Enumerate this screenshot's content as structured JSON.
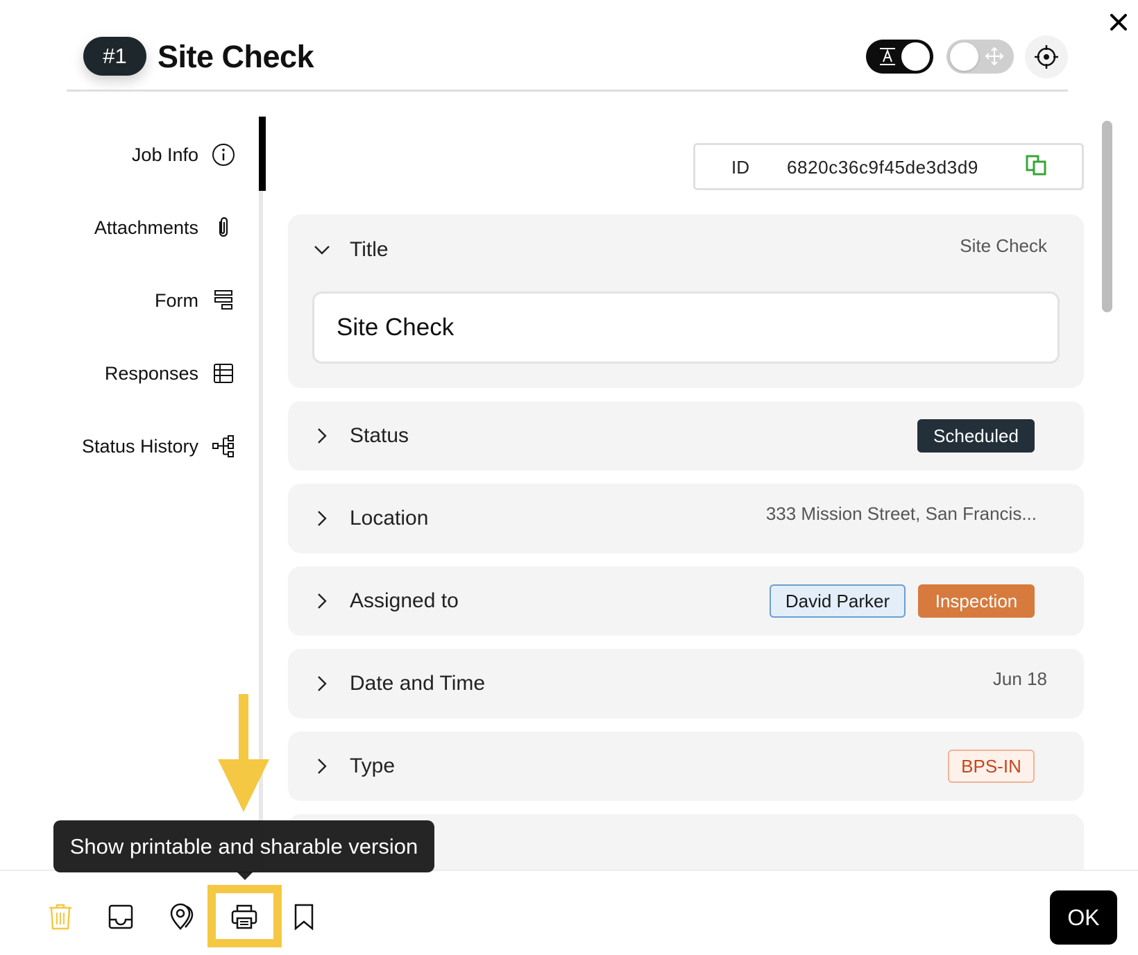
{
  "header": {
    "number_badge": "#1",
    "title": "Site Check"
  },
  "sidebar": {
    "items": [
      {
        "label": "Job Info",
        "icon": "info-circle-icon"
      },
      {
        "label": "Attachments",
        "icon": "paperclip-icon"
      },
      {
        "label": "Form",
        "icon": "form-icon"
      },
      {
        "label": "Responses",
        "icon": "table-icon"
      },
      {
        "label": "Status History",
        "icon": "hierarchy-icon"
      }
    ],
    "active_index": 0
  },
  "id_field": {
    "label": "ID",
    "value": "6820c36c9f45de3d3d9"
  },
  "sections": {
    "title": {
      "label": "Title",
      "summary": "Site Check",
      "input_value": "Site Check"
    },
    "status": {
      "label": "Status",
      "badge": "Scheduled"
    },
    "location": {
      "label": "Location",
      "summary": "333 Mission Street, San Francis..."
    },
    "assigned": {
      "label": "Assigned to",
      "assignee": "David Parker",
      "team": "Inspection"
    },
    "date": {
      "label": "Date and Time",
      "summary": "Jun 18"
    },
    "type": {
      "label": "Type",
      "badge": "BPS-IN"
    }
  },
  "tooltip": {
    "text": "Show printable and sharable version"
  },
  "footer": {
    "icons": [
      "trash-icon",
      "inbox-icon",
      "map-pin-icon",
      "print-icon",
      "bookmark-icon"
    ],
    "ok_label": "OK"
  },
  "colors": {
    "accent_yellow": "#f5c843",
    "status_dark": "#23303a",
    "team_orange": "#d77a3e",
    "type_red": "#c7461d"
  }
}
